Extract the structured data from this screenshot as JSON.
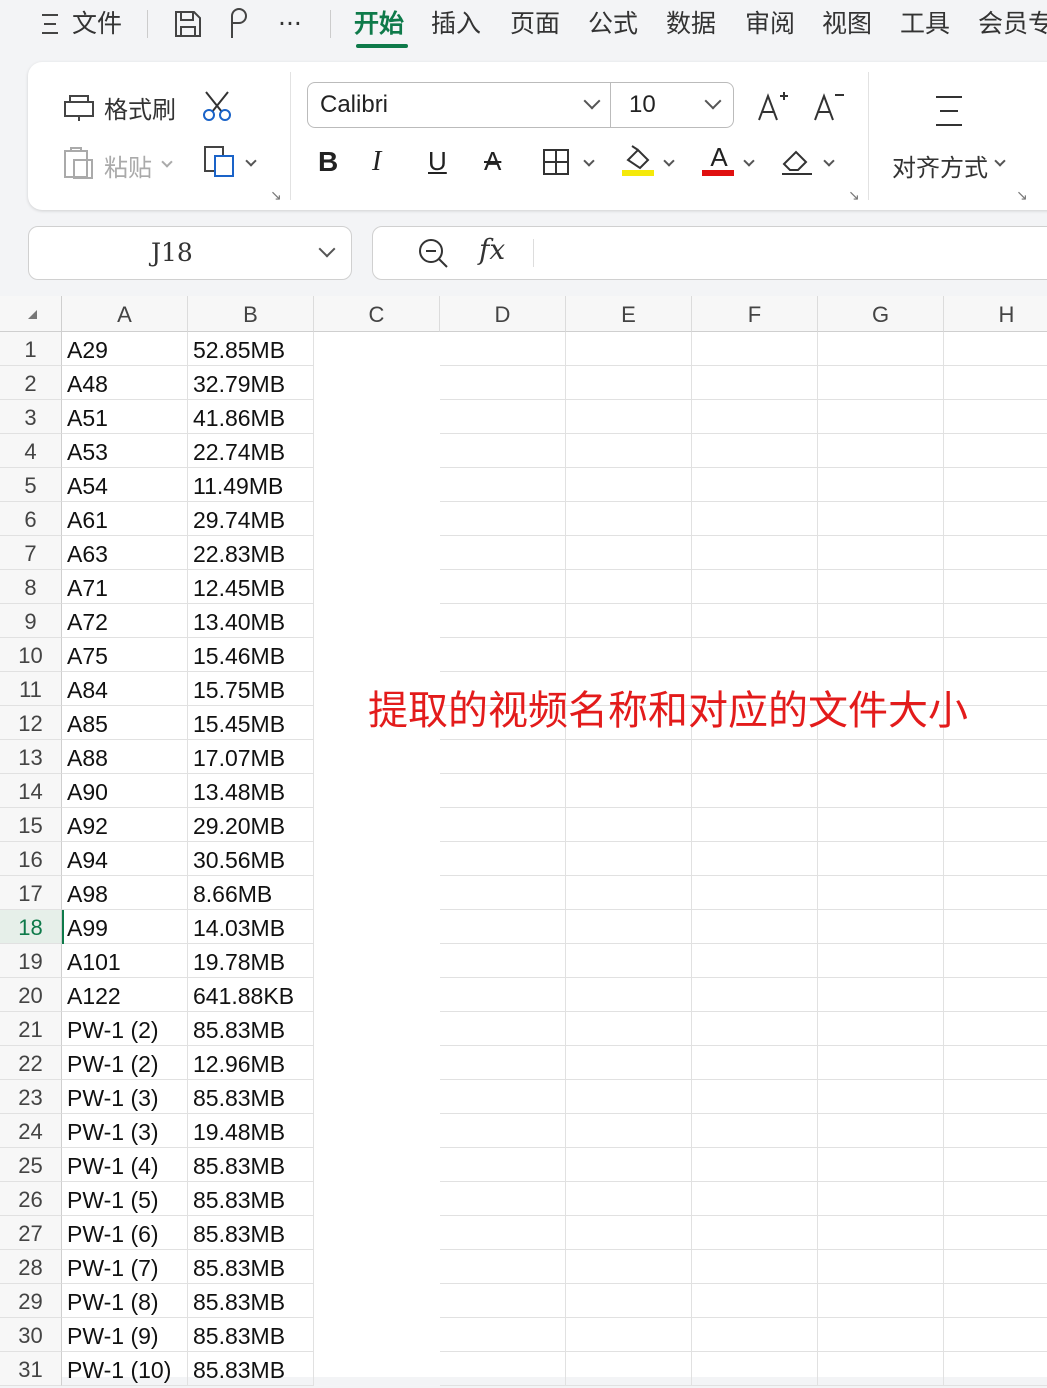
{
  "menubar": {
    "file_label": "文件",
    "more_label": "···",
    "tabs": [
      "开始",
      "插入",
      "页面",
      "公式",
      "数据",
      "审阅",
      "视图",
      "工具",
      "会员专"
    ],
    "active_tab": "开始"
  },
  "ribbon": {
    "format_painter_label": "格式刷",
    "paste_label": "粘贴",
    "font_name": "Calibri",
    "font_size": "10",
    "align_label": "对齐方式",
    "fill_color": "#f5e90a",
    "font_color": "#e01010"
  },
  "namebox": {
    "value": "J18"
  },
  "formula": {
    "fx_label": "fx"
  },
  "grid": {
    "columns": [
      "A",
      "B",
      "C",
      "D",
      "E",
      "F",
      "G",
      "H"
    ],
    "selected_row": "18",
    "rows": [
      {
        "n": "1",
        "a": "A29",
        "b": "52.85MB"
      },
      {
        "n": "2",
        "a": "A48",
        "b": "32.79MB"
      },
      {
        "n": "3",
        "a": "A51",
        "b": "41.86MB"
      },
      {
        "n": "4",
        "a": "A53",
        "b": "22.74MB"
      },
      {
        "n": "5",
        "a": "A54",
        "b": "11.49MB"
      },
      {
        "n": "6",
        "a": "A61",
        "b": "29.74MB"
      },
      {
        "n": "7",
        "a": "A63",
        "b": "22.83MB"
      },
      {
        "n": "8",
        "a": "A71",
        "b": "12.45MB"
      },
      {
        "n": "9",
        "a": "A72",
        "b": "13.40MB"
      },
      {
        "n": "10",
        "a": "A75",
        "b": "15.46MB"
      },
      {
        "n": "11",
        "a": "A84",
        "b": "15.75MB"
      },
      {
        "n": "12",
        "a": "A85",
        "b": "15.45MB"
      },
      {
        "n": "13",
        "a": "A88",
        "b": "17.07MB"
      },
      {
        "n": "14",
        "a": "A90",
        "b": "13.48MB"
      },
      {
        "n": "15",
        "a": "A92",
        "b": "29.20MB"
      },
      {
        "n": "16",
        "a": "A94",
        "b": "30.56MB"
      },
      {
        "n": "17",
        "a": "A98",
        "b": "8.66MB"
      },
      {
        "n": "18",
        "a": "A99",
        "b": "14.03MB"
      },
      {
        "n": "19",
        "a": "A101",
        "b": "19.78MB"
      },
      {
        "n": "20",
        "a": "A122",
        "b": "641.88KB"
      },
      {
        "n": "21",
        "a": "PW-1 (2)",
        "b": "85.83MB"
      },
      {
        "n": "22",
        "a": "PW-1 (2)",
        "b": "12.96MB"
      },
      {
        "n": "23",
        "a": "PW-1 (3)",
        "b": "85.83MB"
      },
      {
        "n": "24",
        "a": "PW-1 (3)",
        "b": "19.48MB"
      },
      {
        "n": "25",
        "a": "PW-1 (4)",
        "b": "85.83MB"
      },
      {
        "n": "26",
        "a": "PW-1 (5)",
        "b": "85.83MB"
      },
      {
        "n": "27",
        "a": "PW-1 (6)",
        "b": "85.83MB"
      },
      {
        "n": "28",
        "a": "PW-1 (7)",
        "b": "85.83MB"
      },
      {
        "n": "29",
        "a": "PW-1 (8)",
        "b": "85.83MB"
      },
      {
        "n": "30",
        "a": "PW-1 (9)",
        "b": "85.83MB"
      },
      {
        "n": "31",
        "a": "PW-1 (10)",
        "b": "85.83MB"
      }
    ],
    "annotation": "提取的视频名称和对应的文件大小"
  }
}
